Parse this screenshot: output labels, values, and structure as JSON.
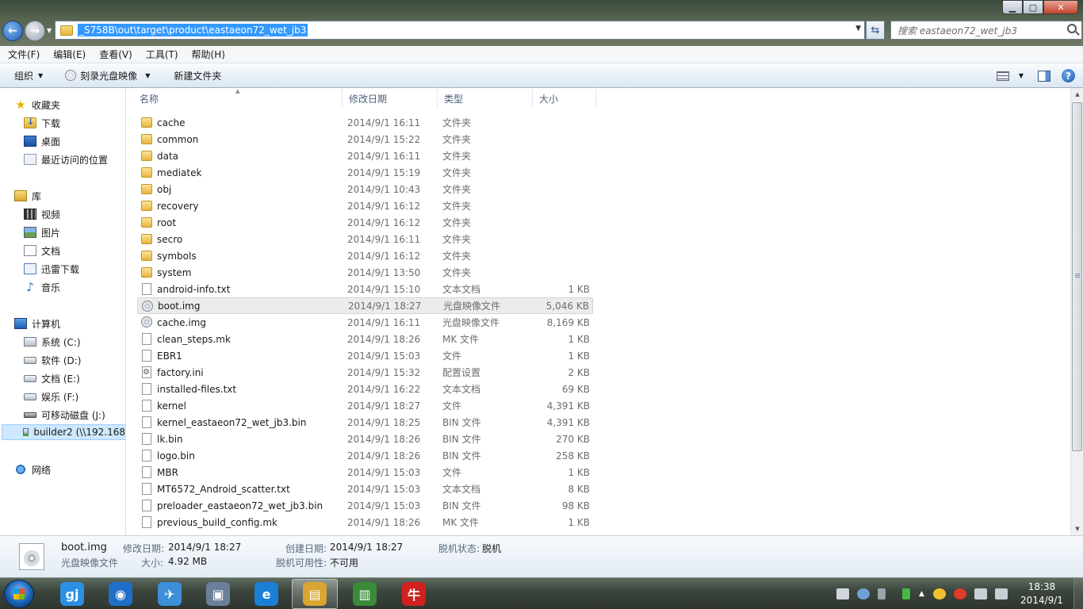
{
  "window": {
    "address_path": "_S758B\\out\\target\\product\\eastaeon72_wet_jb3",
    "search_placeholder": "搜索 eastaeon72_wet_jb3",
    "min_glyph": "▁",
    "max_glyph": "▢",
    "close_glyph": "✕",
    "back_glyph": "←",
    "forward_glyph": "→",
    "refresh_glyph": "⇆"
  },
  "menu": [
    "文件(F)",
    "编辑(E)",
    "查看(V)",
    "工具(T)",
    "帮助(H)"
  ],
  "toolbar": {
    "organize": "组织",
    "burn": "刻录光盘映像",
    "new_folder": "新建文件夹",
    "help": "?"
  },
  "nav": {
    "favorites": "收藏夹",
    "downloads": "下载",
    "desktop": "桌面",
    "recent": "最近访问的位置",
    "libraries": "库",
    "videos": "视频",
    "pictures": "图片",
    "documents": "文档",
    "thunder": "迅雷下载",
    "music": "音乐",
    "computer": "计算机",
    "drive_c": "系统 (C:)",
    "drive_d": "软件 (D:)",
    "drive_e": "文档 (E:)",
    "drive_f": "娱乐 (F:)",
    "drive_j": "可移动磁盘 (J:)",
    "builder": "builder2 (\\\\192.168",
    "network": "网络"
  },
  "columns": {
    "name": "名称",
    "date": "修改日期",
    "type": "类型",
    "size": "大小"
  },
  "files": [
    {
      "name": "cache",
      "date": "2014/9/1 16:11",
      "type": "文件夹",
      "size": "",
      "icon": "folder"
    },
    {
      "name": "common",
      "date": "2014/9/1 15:22",
      "type": "文件夹",
      "size": "",
      "icon": "folder"
    },
    {
      "name": "data",
      "date": "2014/9/1 16:11",
      "type": "文件夹",
      "size": "",
      "icon": "folder"
    },
    {
      "name": "mediatek",
      "date": "2014/9/1 15:19",
      "type": "文件夹",
      "size": "",
      "icon": "folder"
    },
    {
      "name": "obj",
      "date": "2014/9/1 10:43",
      "type": "文件夹",
      "size": "",
      "icon": "folder"
    },
    {
      "name": "recovery",
      "date": "2014/9/1 16:12",
      "type": "文件夹",
      "size": "",
      "icon": "folder"
    },
    {
      "name": "root",
      "date": "2014/9/1 16:12",
      "type": "文件夹",
      "size": "",
      "icon": "folder"
    },
    {
      "name": "secro",
      "date": "2014/9/1 16:11",
      "type": "文件夹",
      "size": "",
      "icon": "folder"
    },
    {
      "name": "symbols",
      "date": "2014/9/1 16:12",
      "type": "文件夹",
      "size": "",
      "icon": "folder"
    },
    {
      "name": "system",
      "date": "2014/9/1 13:50",
      "type": "文件夹",
      "size": "",
      "icon": "folder"
    },
    {
      "name": "android-info.txt",
      "date": "2014/9/1 15:10",
      "type": "文本文档",
      "size": "1 KB",
      "icon": "file"
    },
    {
      "name": "boot.img",
      "date": "2014/9/1 18:27",
      "type": "光盘映像文件",
      "size": "5,046 KB",
      "icon": "disc",
      "selected": true
    },
    {
      "name": "cache.img",
      "date": "2014/9/1 16:11",
      "type": "光盘映像文件",
      "size": "8,169 KB",
      "icon": "disc"
    },
    {
      "name": "clean_steps.mk",
      "date": "2014/9/1 18:26",
      "type": "MK 文件",
      "size": "1 KB",
      "icon": "file"
    },
    {
      "name": "EBR1",
      "date": "2014/9/1 15:03",
      "type": "文件",
      "size": "1 KB",
      "icon": "file"
    },
    {
      "name": "factory.ini",
      "date": "2014/9/1 15:32",
      "type": "配置设置",
      "size": "2 KB",
      "icon": "ini"
    },
    {
      "name": "installed-files.txt",
      "date": "2014/9/1 16:22",
      "type": "文本文档",
      "size": "69 KB",
      "icon": "file"
    },
    {
      "name": "kernel",
      "date": "2014/9/1 18:27",
      "type": "文件",
      "size": "4,391 KB",
      "icon": "file"
    },
    {
      "name": "kernel_eastaeon72_wet_jb3.bin",
      "date": "2014/9/1 18:25",
      "type": "BIN 文件",
      "size": "4,391 KB",
      "icon": "file"
    },
    {
      "name": "lk.bin",
      "date": "2014/9/1 18:26",
      "type": "BIN 文件",
      "size": "270 KB",
      "icon": "file"
    },
    {
      "name": "logo.bin",
      "date": "2014/9/1 18:26",
      "type": "BIN 文件",
      "size": "258 KB",
      "icon": "file"
    },
    {
      "name": "MBR",
      "date": "2014/9/1 15:03",
      "type": "文件",
      "size": "1 KB",
      "icon": "file"
    },
    {
      "name": "MT6572_Android_scatter.txt",
      "date": "2014/9/1 15:03",
      "type": "文本文档",
      "size": "8 KB",
      "icon": "file"
    },
    {
      "name": "preloader_eastaeon72_wet_jb3.bin",
      "date": "2014/9/1 15:03",
      "type": "BIN 文件",
      "size": "98 KB",
      "icon": "file"
    },
    {
      "name": "previous_build_config.mk",
      "date": "2014/9/1 18:26",
      "type": "MK 文件",
      "size": "1 KB",
      "icon": "file"
    }
  ],
  "details": {
    "name": "boot.img",
    "type": "光盘映像文件",
    "modified_label": "修改日期:",
    "modified_value": "2014/9/1 18:27",
    "size_label": "大小:",
    "size_value": "4.92 MB",
    "created_label": "创建日期:",
    "created_value": "2014/9/1 18:27",
    "offline_status_label": "脱机状态:",
    "offline_status_value": "脱机",
    "offline_avail_label": "脱机可用性:",
    "offline_avail_value": "不可用"
  },
  "taskbar": {
    "time": "18:38",
    "date": "2014/9/1",
    "apps": [
      {
        "name": "qq-browser-icon",
        "glyph": "gj",
        "color": "#2b8fe6",
        "active": false
      },
      {
        "name": "360-browser-icon",
        "glyph": "◉",
        "color": "#1f6fc8",
        "active": false
      },
      {
        "name": "swift-icon",
        "glyph": "✈",
        "color": "#3c8fd8",
        "active": false
      },
      {
        "name": "control-panel-icon",
        "glyph": "▣",
        "color": "#6a7f9a",
        "active": false
      },
      {
        "name": "ie-icon",
        "glyph": "e",
        "color": "#1c7fd6",
        "active": false
      },
      {
        "name": "explorer-icon",
        "glyph": "▤",
        "color": "#d9a632",
        "active": true
      },
      {
        "name": "android-icon",
        "glyph": "▥",
        "color": "#3a8a3a",
        "active": false
      },
      {
        "name": "niu-icon",
        "glyph": "牛",
        "color": "#d02020",
        "active": false
      }
    ]
  },
  "colors": {
    "selection": "#3399ff",
    "secondary_text": "#6d6d6d"
  }
}
